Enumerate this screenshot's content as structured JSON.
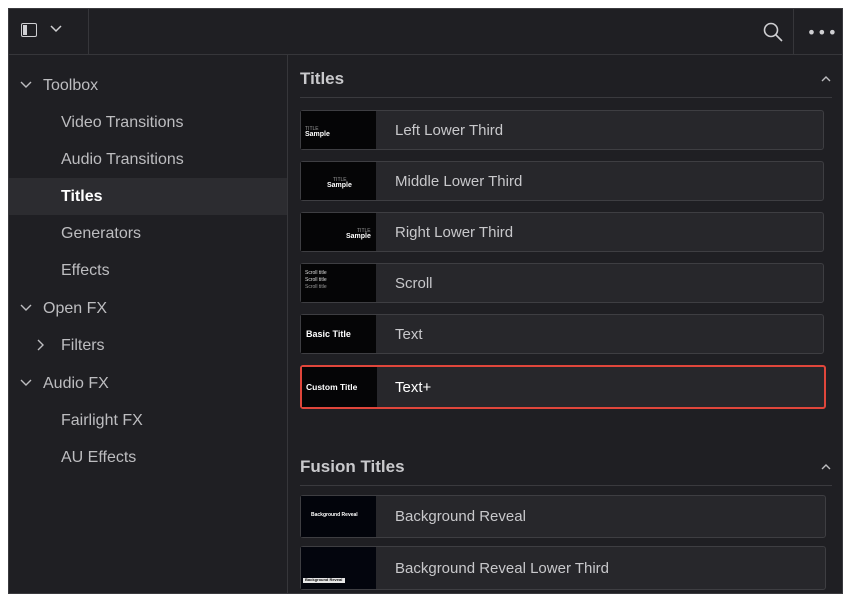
{
  "toolbar": {
    "panel_icon": "sidebar-toggle-icon",
    "chevron_icon": "chevron-down-icon",
    "search_icon": "search-icon",
    "more_icon": "more-icon",
    "more_glyph": "•••"
  },
  "sidebar": {
    "items": [
      {
        "label": "Toolbox",
        "expanded": true
      },
      {
        "label": "Video Transitions"
      },
      {
        "label": "Audio Transitions"
      },
      {
        "label": "Titles",
        "selected": true
      },
      {
        "label": "Generators"
      },
      {
        "label": "Effects"
      },
      {
        "label": "Open FX",
        "expanded": true
      },
      {
        "label": "Filters",
        "expanded": false
      },
      {
        "label": "Audio FX",
        "expanded": true
      },
      {
        "label": "Fairlight FX"
      },
      {
        "label": "AU Effects"
      }
    ]
  },
  "titles": {
    "heading": "Titles",
    "items": [
      {
        "label": "Left Lower Third",
        "thumb_small": "TITLE",
        "thumb_big": "Sample"
      },
      {
        "label": "Middle Lower Third",
        "thumb_small": "TITLE",
        "thumb_big": "Sample"
      },
      {
        "label": "Right Lower Third",
        "thumb_small": "TITLE",
        "thumb_big": "Sample"
      },
      {
        "label": "Scroll",
        "thumb_lines": [
          "Scroll title",
          "Scroll title",
          "Scroll title"
        ]
      },
      {
        "label": "Text",
        "thumb_text": "Basic Title"
      },
      {
        "label": "Text+",
        "thumb_text": "Custom Title",
        "selected": true
      }
    ]
  },
  "fusion_titles": {
    "heading": "Fusion Titles",
    "items": [
      {
        "label": "Background Reveal",
        "thumb_text": "Background Reveal"
      },
      {
        "label": "Background Reveal Lower Third",
        "thumb_text": "Background Reveal"
      }
    ]
  },
  "colors": {
    "background": "#1f1f23",
    "selection_border": "#e0463b",
    "selected_row": "#2c2c30"
  }
}
